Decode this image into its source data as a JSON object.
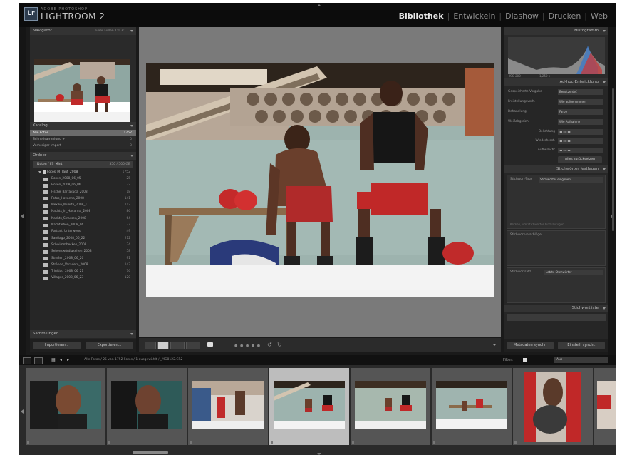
{
  "app": {
    "logo_badge": "Lr",
    "company": "ADOBE PHOTOSHOP",
    "name": "LIGHTROOM 2"
  },
  "modules": [
    "Bibliothek",
    "Entwickeln",
    "Diashow",
    "Drucken",
    "Web"
  ],
  "active_module": "Bibliothek",
  "left_panel": {
    "navigator": {
      "title": "Navigator",
      "options": "Fixer  Füllen  1:1  3:1"
    },
    "catalog": {
      "title": "Katalog",
      "items": [
        {
          "label": "Alle Fotos",
          "count": "1752"
        },
        {
          "label": "Schnellsammlung +",
          "count": "0"
        },
        {
          "label": "Vorheriger Import",
          "count": "3"
        }
      ]
    },
    "folders": {
      "title": "Ordner",
      "volume": {
        "label": "Daten / FS_Mint",
        "count": "350 / 500 GB"
      },
      "drive": {
        "label": "Fotos_M_Tauf_2008",
        "count": "1752"
      },
      "items": [
        {
          "label": "Boxen_2008_06_05",
          "count": "25"
        },
        {
          "label": "Boxen_2008_06_06",
          "count": "32"
        },
        {
          "label": "Fische_Barrakuda_2008",
          "count": "18"
        },
        {
          "label": "Fotos_Havanna_2008",
          "count": "141"
        },
        {
          "label": "Mexiko_Muerte_2008_1",
          "count": "112"
        },
        {
          "label": "Nachts_in_Havanna_2008",
          "count": "86"
        },
        {
          "label": "Nachts_Strassen_2008",
          "count": "64"
        },
        {
          "label": "Nachtleben_2008_06",
          "count": "77"
        },
        {
          "label": "Portrait_Unterwegs",
          "count": "49"
        },
        {
          "label": "Santiago_2008_06_22",
          "count": "212"
        },
        {
          "label": "Schwimmbecken_2008",
          "count": "34"
        },
        {
          "label": "Sehenswürdigkeiten_2008",
          "count": "58"
        },
        {
          "label": "Straßen_2008_06_20",
          "count": "91"
        },
        {
          "label": "Strände_Varadero_2008",
          "count": "143"
        },
        {
          "label": "Trinidad_2008_06_21",
          "count": "76"
        },
        {
          "label": "Villages_2008_06_23",
          "count": "120"
        }
      ]
    },
    "collections": {
      "title": "Sammlungen"
    },
    "import_button": "Importieren...",
    "export_button": "Exportieren..."
  },
  "right_panel": {
    "histogram": {
      "title": "Histogramm",
      "readout_left": "ISO 200",
      "readout_right": "1/250 s"
    },
    "quick_develop": {
      "title": "Ad-hoc-Entwicklung",
      "preset_label": "Gespeicherte Vorgabe",
      "preset_value": "Benutzerdef.",
      "crop_label": "Freistellungsverh.",
      "crop_value": "Wie aufgenommen",
      "treatment_label": "Behandlung",
      "treatment_value": "Farbe",
      "wb_label": "Weißabgleich",
      "wb_value": "Wie Aufnahme",
      "tone_rows": [
        {
          "label": "Belichtung",
          "value": "◂◂ ◂ ▸ ▸▸"
        },
        {
          "label": "Wiederherst.",
          "value": "◂◂ ◂ ▸ ▸▸"
        },
        {
          "label": "Aufhelllicht",
          "value": "◂◂ ◂ ▸ ▸▸"
        }
      ],
      "reset_button": "Alles zurücksetzen"
    },
    "keywords": {
      "title": "Stichwörter festlegen",
      "tag_label": "Stichwort-Tags",
      "tag_value": "Stichwörter eingeben",
      "hint": "Klicken, um Stichwörter hinzuzufügen",
      "suggestions_label": "Stichwortvorschläge",
      "set_label": "Stichwortsatz",
      "set_value": "Letzte Stichwörter"
    },
    "keyword_list": {
      "title": "Stichwortliste"
    },
    "sync_button": "Metadaten synchr.",
    "settings_button": "Einstell. synchr."
  },
  "filmstrip_bar": {
    "path": "Alle Fotos / 25 von 1752 Fotos / 1 ausgewählt / _MG8122.CR2",
    "filter_label": "Filter:",
    "filter_value": "Aus"
  },
  "filmstrip": {
    "count_visible": 8,
    "selected_index": 3
  },
  "colors": {
    "accent_selected": "#bdbdbd",
    "panel_bg": "#262626",
    "work_area": "#7a7a7a"
  }
}
